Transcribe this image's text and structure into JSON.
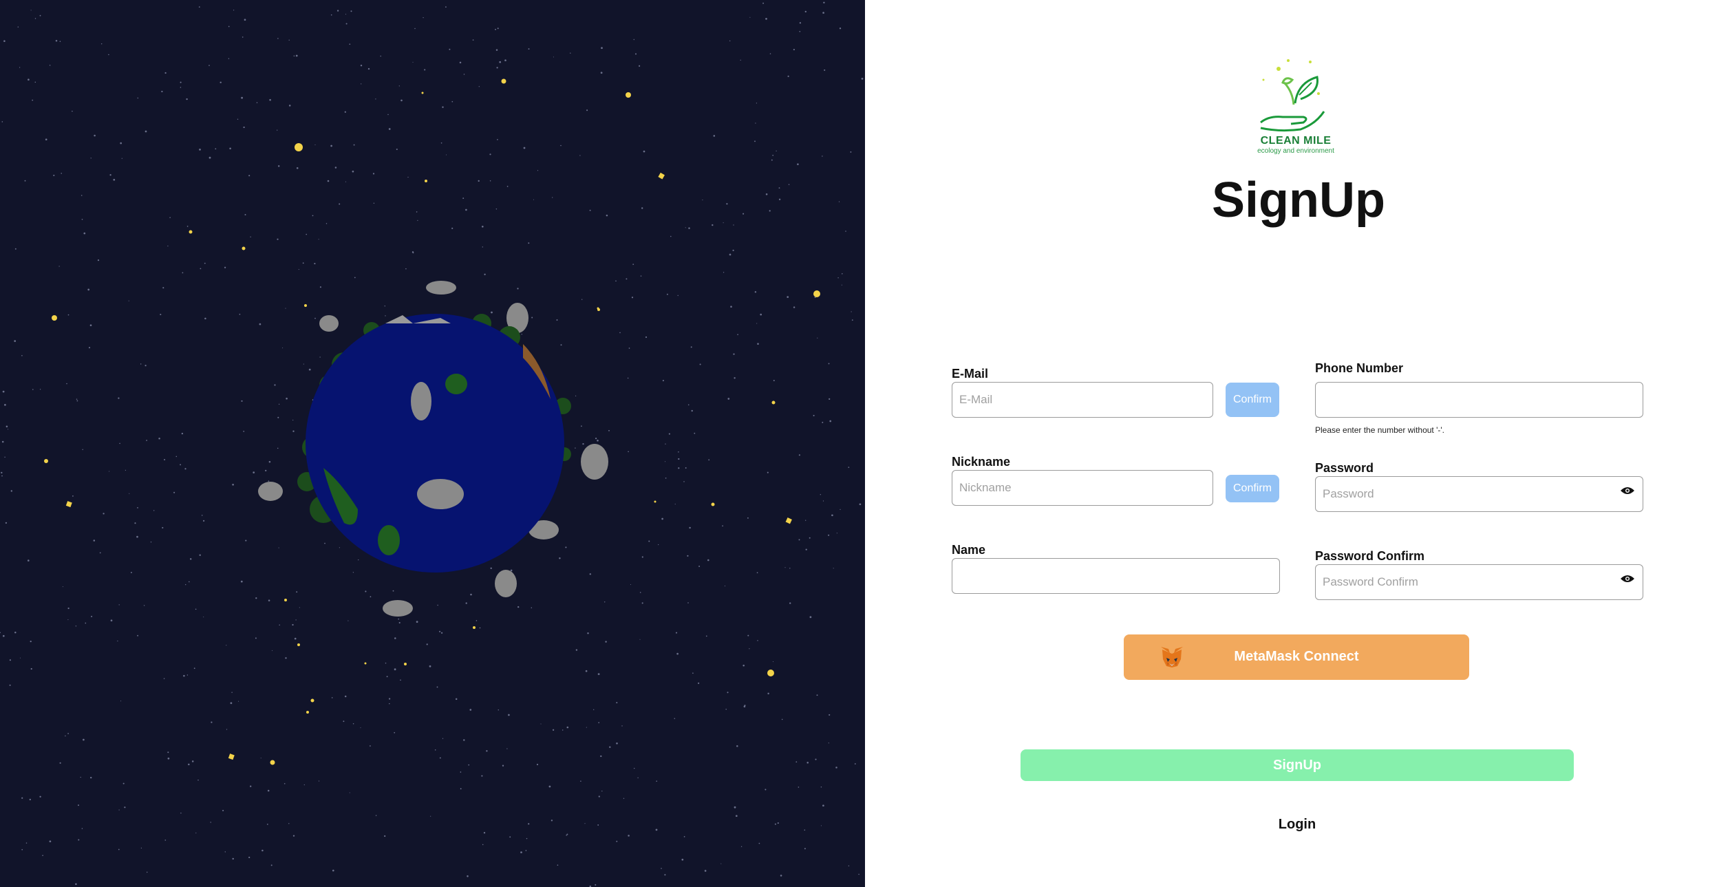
{
  "brand": {
    "name": "CLEAN MILE",
    "tagline": "ecology and environment"
  },
  "title": "SignUp",
  "form": {
    "email": {
      "label": "E-Mail",
      "placeholder": "E-Mail",
      "confirm_label": "Confirm"
    },
    "nickname": {
      "label": "Nickname",
      "placeholder": "Nickname",
      "confirm_label": "Confirm"
    },
    "name": {
      "label": "Name",
      "placeholder": ""
    },
    "phone": {
      "label": "Phone Number",
      "placeholder": "",
      "hint": "Please enter the number without '-'."
    },
    "password": {
      "label": "Password",
      "placeholder": "Password"
    },
    "password_confirm": {
      "label": "Password Confirm",
      "placeholder": "Password Confirm"
    }
  },
  "buttons": {
    "metamask": "MetaMask Connect",
    "signup": "SignUp",
    "login": "Login"
  },
  "colors": {
    "space_bg": "#11142a",
    "ocean": "#061370",
    "confirm": "#93c2f5",
    "metamask": "#f2a95d",
    "signup": "#86f0ac",
    "brand_green": "#1a7f37"
  },
  "icons": {
    "eye": "eye-icon",
    "fox": "metamask-fox-icon",
    "logo": "plant-in-hand-logo"
  }
}
